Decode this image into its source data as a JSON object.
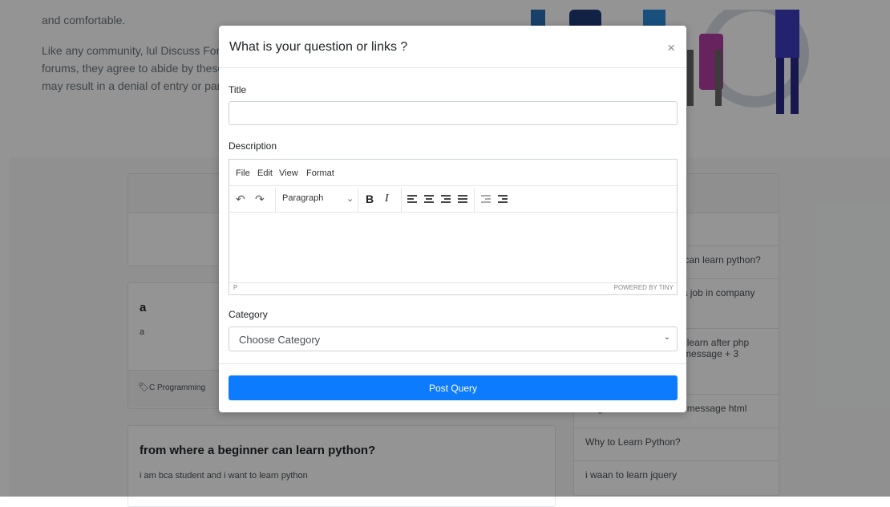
{
  "background": {
    "intro_fragment": "and comfortable.",
    "guidelines_text": "Like any community, lul Discuss Forum has guidelines. When members join our forums, they agree to abide by these rules. Serious violations of these standards may result in a denial of entry or participation in the community.",
    "questions": [
      {
        "title": "a",
        "description": "a",
        "category": "C Programming"
      },
      {
        "title": "from where a beginner can learn python?",
        "description": "i am bca student and i want to learn python"
      }
    ],
    "sidebar_items": [
      "from where a beginner can learn python?",
      "what can i learn to get a job in company php after",
      "what language should I learn after php registration successful message + 3",
      "Registration successful message html",
      "Why to Learn Python?",
      "i waan to learn jquery"
    ]
  },
  "modal": {
    "title": "What is your question or links ?",
    "close_symbol": "×",
    "title_label": "Title",
    "title_value": "",
    "description_label": "Description",
    "editor": {
      "menu": [
        "File",
        "Edit",
        "View",
        "Format"
      ],
      "block_format": "Paragraph",
      "status_path": "P",
      "powered_by": "POWERED BY TINY"
    },
    "category_label": "Category",
    "category_selected": "Choose Category",
    "submit_label": "Post Query"
  },
  "colors": {
    "primary_button": "#0d7bfd",
    "overlay": "rgba(0,0,0,0.42)"
  }
}
